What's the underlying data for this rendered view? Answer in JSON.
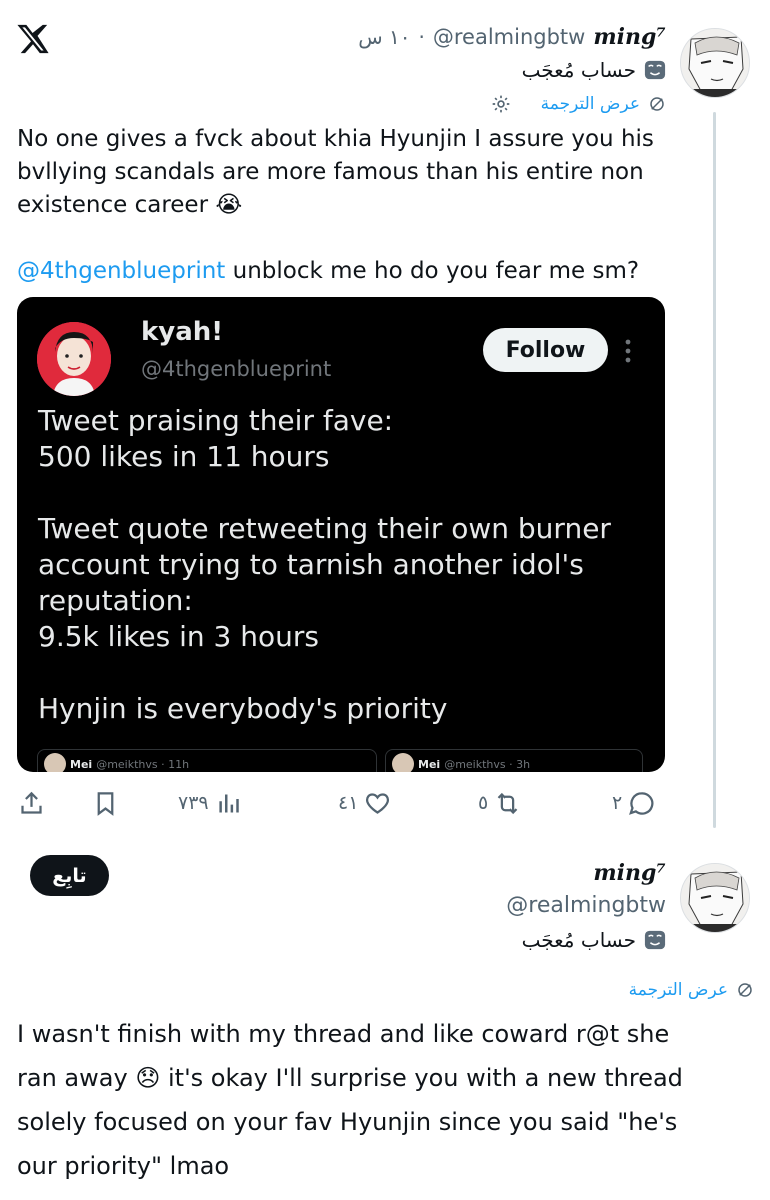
{
  "tweet1": {
    "display_name": "ming⁷",
    "handle": "@realmingbtw",
    "time": "١٠ س",
    "account_label": "حساب مُعجَب",
    "translate_label": "عرض الترجمة",
    "text_line1": "No one gives a fvck about khia Hyunjin I assure you his",
    "text_line2": "bvllying scandals are more famous than his entire non",
    "text_line3": "existence career",
    "text_emoji": "😭",
    "mention": "@4thgenblueprint",
    "mention_rest": " unblock me ho do you fear me sm?"
  },
  "embedded": {
    "name": "kyah!",
    "handle": "@4thgenblueprint",
    "follow_label": "Follow",
    "lines": [
      "Tweet praising their fave:",
      "500 likes in 11 hours",
      "",
      "Tweet quote retweeting their own burner",
      "account trying to tarnish another idol's",
      "reputation:",
      "9.5k likes in 3 hours",
      "",
      "Hynjin is everybody's priority"
    ],
    "mini_left_name": "Mei",
    "mini_left_meta": "@meikthvs · 11h",
    "mini_right_name": "Mei",
    "mini_right_meta": "@meikthvs · 3h"
  },
  "actions": {
    "views": "٧٣٩",
    "likes": "٤١",
    "retweets": "٥",
    "replies": "٢"
  },
  "tweet2": {
    "follow_label": "تابِع",
    "display_name": "ming⁷",
    "handle": "@realmingbtw",
    "account_label": "حساب مُعجَب",
    "translate_label": "عرض الترجمة",
    "text_line1": "I wasn't finish with my thread and like coward r@t she",
    "text_line2a": "ran away",
    "text_emoji": "😞",
    "text_line2b": "it's okay I'll surprise you with a new thread",
    "text_line3": "solely focused on your fav Hyunjin since you said \"he's",
    "text_line4": "our priority\" lmao"
  },
  "colors": {
    "accent": "#1d9bf0",
    "text": "#0f1419",
    "muted": "#536471",
    "card_bg": "#000000"
  },
  "icons": [
    "x-logo-icon",
    "mask-icon",
    "translate-icon",
    "gear-icon",
    "share-icon",
    "bookmark-icon",
    "views-icon",
    "heart-icon",
    "retweet-icon",
    "reply-icon",
    "more-vertical-icon"
  ]
}
